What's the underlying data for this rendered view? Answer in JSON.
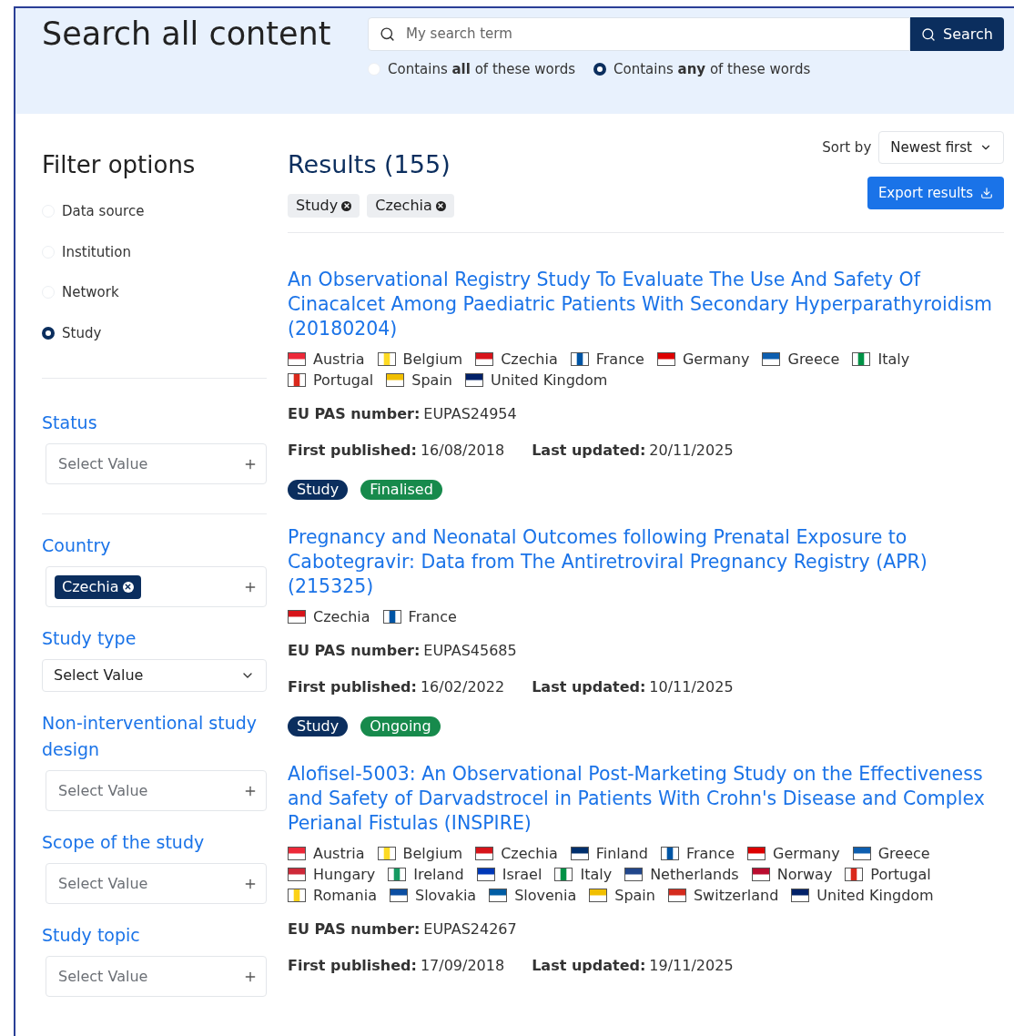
{
  "header": {
    "title": "Search all content",
    "search": {
      "placeholder": "My search term",
      "button": "Search"
    },
    "match_options": [
      {
        "label": "Contains **all** of these words",
        "selected": false
      },
      {
        "label": "Contains **any** of these words",
        "selected": true
      }
    ]
  },
  "sidebar": {
    "title": "Filter options",
    "types": [
      {
        "label": "Data source",
        "selected": false
      },
      {
        "label": "Institution",
        "selected": false
      },
      {
        "label": "Network",
        "selected": false
      },
      {
        "label": "Study",
        "selected": true
      }
    ],
    "filters": [
      {
        "label": "Status",
        "kind": "multi",
        "placeholder": "Select Value",
        "divider": true
      },
      {
        "label": "Country",
        "kind": "multi",
        "chips": [
          "Czechia"
        ],
        "divider": false
      },
      {
        "label": "Study type",
        "kind": "dropdown",
        "value": "Select Value",
        "divider": false
      },
      {
        "label": "Non-interventional study design",
        "kind": "multi",
        "placeholder": "Select Value",
        "divider": false
      },
      {
        "label": "Scope of the study",
        "kind": "multi",
        "placeholder": "Select Value",
        "divider": false
      },
      {
        "label": "Study topic",
        "kind": "multi",
        "placeholder": "Select Value",
        "divider": false
      }
    ]
  },
  "results_header": {
    "title": "Results (155)",
    "sort_label": "Sort by",
    "sort_value": "Newest first",
    "active_filters": [
      "Study",
      "Czechia"
    ],
    "export_button": "Export results"
  },
  "results": [
    {
      "title": "An Observational Registry Study To Evaluate The Use And Safety Of Cinacalcet Among Paediatric Patients With Secondary Hyperparathyroidism (20180204)",
      "countries": [
        {
          "name": "Austria",
          "kind": "h",
          "color": "#ed2939"
        },
        {
          "name": "Belgium",
          "kind": "v",
          "color": "#fdda24"
        },
        {
          "name": "Czechia",
          "kind": "h",
          "color": "#d7141a"
        },
        {
          "name": "France",
          "kind": "v",
          "color": "#0055a4"
        },
        {
          "name": "Germany",
          "kind": "h",
          "color": "#dd0000"
        },
        {
          "name": "Greece",
          "kind": "h",
          "color": "#0d5eaf"
        },
        {
          "name": "Italy",
          "kind": "v",
          "color": "#009246"
        },
        {
          "name": "Portugal",
          "kind": "v",
          "color": "#da291c"
        },
        {
          "name": "Spain",
          "kind": "h",
          "color": "#f1bf00"
        },
        {
          "name": "United Kingdom",
          "kind": "h",
          "color": "#012169"
        }
      ],
      "eu_pas_label": "EU PAS number:",
      "eu_pas": "EUPAS24954",
      "first_published_label": "First published:",
      "first_published": "16/08/2018",
      "last_updated_label": "Last updated:",
      "last_updated": "20/11/2025",
      "tags": [
        {
          "label": "Study",
          "color": "#0b2e5e"
        },
        {
          "label": "Finalised",
          "color": "#178a4c"
        }
      ]
    },
    {
      "title": "Pregnancy and Neonatal Outcomes following Prenatal Exposure to Cabotegravir: Data from The Antiretroviral Pregnancy Registry (APR) (215325)",
      "countries": [
        {
          "name": "Czechia",
          "kind": "h",
          "color": "#d7141a"
        },
        {
          "name": "France",
          "kind": "v",
          "color": "#0055a4"
        }
      ],
      "eu_pas_label": "EU PAS number:",
      "eu_pas": "EUPAS45685",
      "first_published_label": "First published:",
      "first_published": "16/02/2022",
      "last_updated_label": "Last updated:",
      "last_updated": "10/11/2025",
      "tags": [
        {
          "label": "Study",
          "color": "#0b2e5e"
        },
        {
          "label": "Ongoing",
          "color": "#178a4c"
        }
      ]
    },
    {
      "title": "Alofisel-5003: An Observational Post-Marketing Study on the Effectiveness and Safety of Darvadstrocel in Patients With Crohn's Disease and Complex Perianal Fistulas (INSPIRE)",
      "countries": [
        {
          "name": "Austria",
          "kind": "h",
          "color": "#ed2939"
        },
        {
          "name": "Belgium",
          "kind": "v",
          "color": "#fdda24"
        },
        {
          "name": "Czechia",
          "kind": "h",
          "color": "#d7141a"
        },
        {
          "name": "Finland",
          "kind": "h",
          "color": "#002f6c"
        },
        {
          "name": "France",
          "kind": "v",
          "color": "#0055a4"
        },
        {
          "name": "Germany",
          "kind": "h",
          "color": "#dd0000"
        },
        {
          "name": "Greece",
          "kind": "h",
          "color": "#0d5eaf"
        },
        {
          "name": "Hungary",
          "kind": "h",
          "color": "#ce2939"
        },
        {
          "name": "Ireland",
          "kind": "v",
          "color": "#169b62"
        },
        {
          "name": "Israel",
          "kind": "h",
          "color": "#0038b8"
        },
        {
          "name": "Italy",
          "kind": "v",
          "color": "#009246"
        },
        {
          "name": "Netherlands",
          "kind": "h",
          "color": "#21468b"
        },
        {
          "name": "Norway",
          "kind": "h",
          "color": "#ba0c2f"
        },
        {
          "name": "Portugal",
          "kind": "v",
          "color": "#da291c"
        },
        {
          "name": "Romania",
          "kind": "v",
          "color": "#fcd116"
        },
        {
          "name": "Slovakia",
          "kind": "h",
          "color": "#0b4ea2"
        },
        {
          "name": "Slovenia",
          "kind": "h",
          "color": "#005da4"
        },
        {
          "name": "Spain",
          "kind": "h",
          "color": "#f1bf00"
        },
        {
          "name": "Switzerland",
          "kind": "h",
          "color": "#d52b1e"
        },
        {
          "name": "United Kingdom",
          "kind": "h",
          "color": "#012169"
        }
      ],
      "eu_pas_label": "EU PAS number:",
      "eu_pas": "EUPAS24267",
      "first_published_label": "First published:",
      "first_published": "17/09/2018",
      "last_updated_label": "Last updated:",
      "last_updated": "19/11/2025"
    }
  ]
}
